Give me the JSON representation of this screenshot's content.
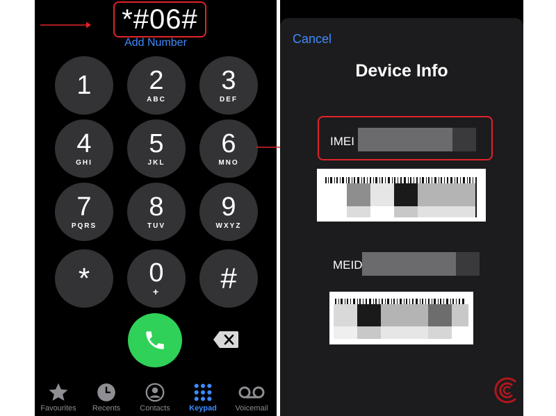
{
  "dialer": {
    "number": "*#06#",
    "add_number": "Add Number",
    "keys": [
      {
        "digit": "1",
        "letters": ""
      },
      {
        "digit": "2",
        "letters": "ABC"
      },
      {
        "digit": "3",
        "letters": "DEF"
      },
      {
        "digit": "4",
        "letters": "GHI"
      },
      {
        "digit": "5",
        "letters": "JKL"
      },
      {
        "digit": "6",
        "letters": "MNO"
      },
      {
        "digit": "7",
        "letters": "PQRS"
      },
      {
        "digit": "8",
        "letters": "TUV"
      },
      {
        "digit": "9",
        "letters": "WXYZ"
      },
      {
        "digit": "*",
        "letters": ""
      },
      {
        "digit": "0",
        "letters": "+"
      },
      {
        "digit": "#",
        "letters": ""
      }
    ]
  },
  "tabbar": {
    "items": [
      {
        "label": "Favourites",
        "icon": "star-icon",
        "active": false
      },
      {
        "label": "Recents",
        "icon": "clock-icon",
        "active": false
      },
      {
        "label": "Contacts",
        "icon": "contact-icon",
        "active": false
      },
      {
        "label": "Keypad",
        "icon": "keypad-icon",
        "active": true
      },
      {
        "label": "Voicemail",
        "icon": "voicemail-icon",
        "active": false
      }
    ]
  },
  "device_info": {
    "cancel": "Cancel",
    "title": "Device Info",
    "imei_label": "IMEI",
    "meid_label": "MEID"
  },
  "colors": {
    "accent": "#3f8bff",
    "call": "#2fd158",
    "highlight": "#e0242a",
    "key": "#333335",
    "sheet": "#1c1c1e"
  }
}
